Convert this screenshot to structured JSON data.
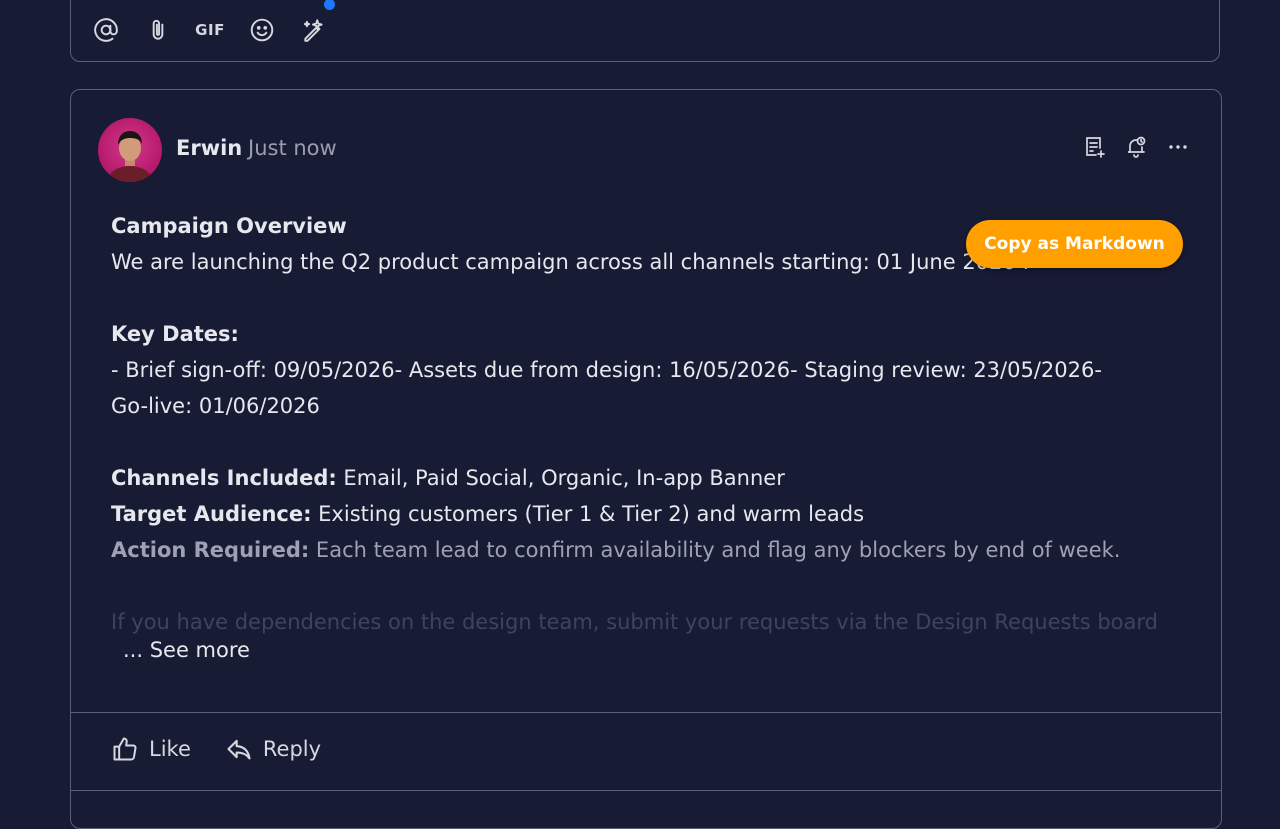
{
  "composer": {
    "tools": [
      {
        "name": "mention-icon"
      },
      {
        "name": "attach-icon"
      },
      {
        "name": "gif-icon",
        "label": "GIF"
      },
      {
        "name": "emoji-icon"
      },
      {
        "name": "magic-wand-icon"
      }
    ]
  },
  "post": {
    "author": "Erwin",
    "time": "Just now",
    "header_actions": [
      "add-to-notes-icon",
      "reminder-bell-icon",
      "more-options-icon"
    ],
    "content": {
      "overview_heading": "Campaign Overview",
      "overview_line": "We are launching the Q2 product campaign across all channels starting:  01  June 2026  .",
      "key_dates_heading": "Key Dates:",
      "key_dates_line1": "- Brief sign-off: 09/05/2026- Assets due from design: 16/05/2026- Staging review: 23/05/2026-",
      "key_dates_line2": "Go-live: 01/06/2026",
      "channels_label": "Channels Included:",
      "channels_value": " Email, Paid Social, Organic, In-app Banner",
      "audience_label": "Target Audience:",
      "audience_value": " Existing customers (Tier 1 & Tier 2) and warm leads",
      "action_label": "Action Required:",
      "action_value": " Each team lead to confirm availability and flag any blockers by end of week.",
      "dependencies_line": "If you have dependencies on the design team, submit your requests via the Design Requests board"
    },
    "copy_markdown_label": "Copy as Markdown",
    "see_more_label": "... See more",
    "like_label": "Like",
    "reply_label": "Reply"
  },
  "colors": {
    "background": "#181b34",
    "border": "#5b5f78",
    "accent_orange": "#ff9f00",
    "dot_blue": "#1f76ff"
  }
}
